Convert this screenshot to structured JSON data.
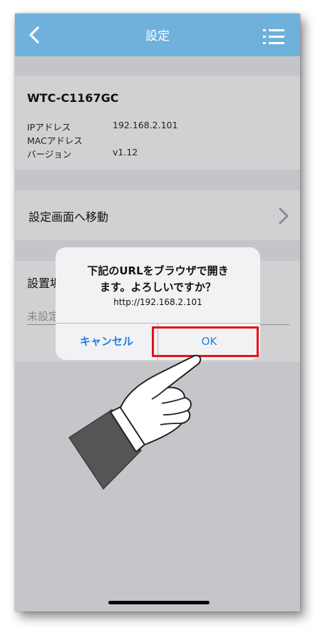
{
  "nav": {
    "title": "設定",
    "back_icon": "chevron-left-icon",
    "menu_icon": "list-menu-icon"
  },
  "device": {
    "name": "WTC-C1167GC",
    "ip_label": "IPアドレス",
    "ip_value": "192.168.2.101",
    "mac_label": "MACアドレス",
    "mac_value": "",
    "version_label": "バージョン",
    "version_value": "v1.12"
  },
  "settings_link": {
    "label": "設定画面へ移動",
    "icon": "chevron-right-icon"
  },
  "location": {
    "label": "設置場",
    "placeholder": "未設定"
  },
  "dialog": {
    "title_line1": "下記のURLをブラウザで開き",
    "title_line2": "ます。よろしいですか？",
    "message": "http://192.168.2.101",
    "cancel_label": "キャンセル",
    "ok_label": "OK"
  },
  "colors": {
    "navbar": "#6fb1db",
    "accent": "#1f7fe0",
    "highlight": "#e3121b"
  }
}
